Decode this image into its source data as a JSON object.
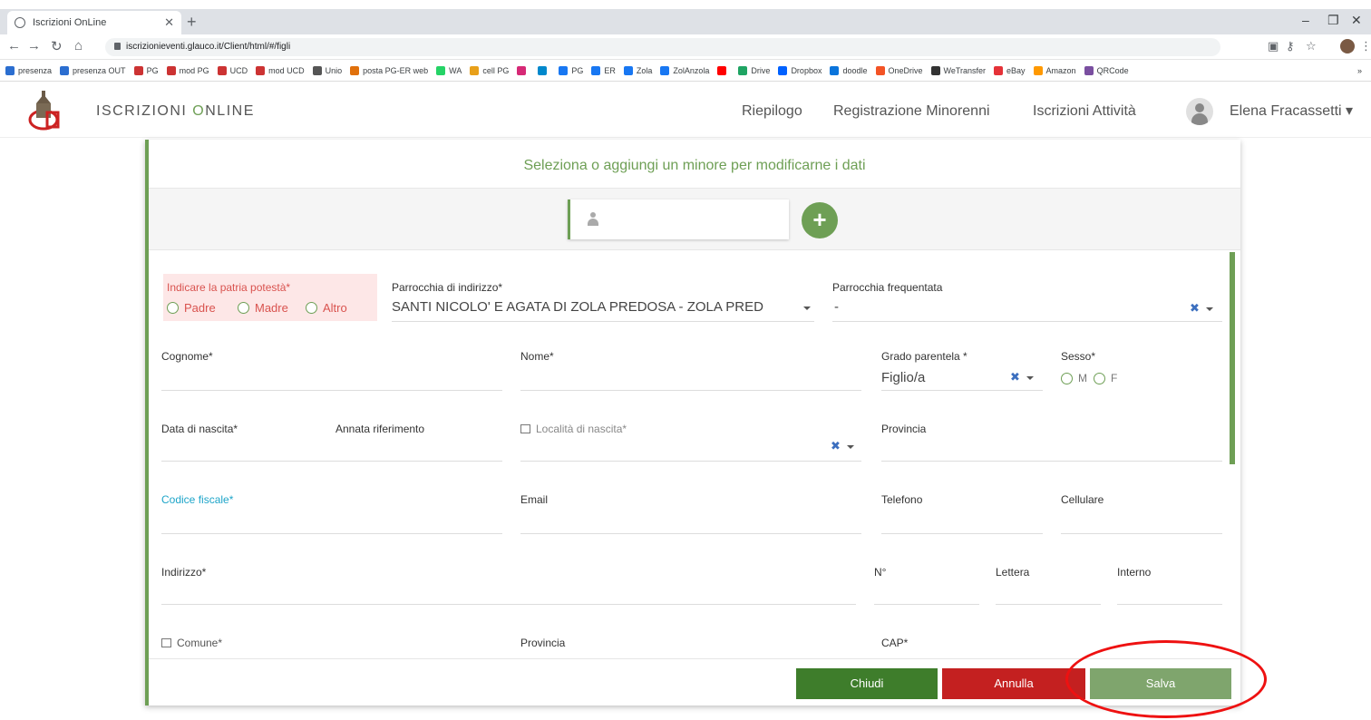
{
  "browser": {
    "tab_title": "Iscrizioni OnLine",
    "url": "iscrizionieventi.glauco.it/Client/html/#/figli",
    "bookmarks": [
      {
        "label": "presenza",
        "color": "#2b6ed0"
      },
      {
        "label": "presenza OUT",
        "color": "#2b6ed0"
      },
      {
        "label": "PG",
        "color": "#c33"
      },
      {
        "label": "mod PG",
        "color": "#c33"
      },
      {
        "label": "UCD",
        "color": "#c33"
      },
      {
        "label": "mod UCD",
        "color": "#c33"
      },
      {
        "label": "Unio",
        "color": "#555"
      },
      {
        "label": "posta PG-ER web",
        "color": "#e0700b"
      },
      {
        "label": "WA",
        "color": "#25d366"
      },
      {
        "label": "cell PG",
        "color": "#e8a01a"
      },
      {
        "label": "",
        "color": "#d62976"
      },
      {
        "label": "",
        "color": "#0088cc"
      },
      {
        "label": "PG",
        "color": "#1877f2"
      },
      {
        "label": "ER",
        "color": "#1877f2"
      },
      {
        "label": "Zola",
        "color": "#1877f2"
      },
      {
        "label": "ZolAnzola",
        "color": "#1877f2"
      },
      {
        "label": "",
        "color": "#ff0000"
      },
      {
        "label": "Drive",
        "color": "#1fa463"
      },
      {
        "label": "Dropbox",
        "color": "#0061ff"
      },
      {
        "label": "doodle",
        "color": "#0a74db"
      },
      {
        "label": "OneDrive",
        "color": "#f35325"
      },
      {
        "label": "WeTransfer",
        "color": "#333"
      },
      {
        "label": "eBay",
        "color": "#e53238"
      },
      {
        "label": "Amazon",
        "color": "#ff9900"
      },
      {
        "label": "QRCode",
        "color": "#7a4fa0"
      }
    ],
    "more": "»"
  },
  "app": {
    "brand_prefix": "IS",
    "brand_mid1": "CRIZIONI ",
    "brand_o": "O",
    "brand_rest": "NLINE",
    "nav": [
      "Riepilogo",
      "Registrazione Minorenni",
      "Iscrizioni Attività"
    ],
    "user": "Elena Fracassetti ▾"
  },
  "modal": {
    "title": "Seleziona o aggiungi un minore per modificarne i dati",
    "add_symbol": "+",
    "patria_label": "Indicare la patria potestà*",
    "patria_options": [
      "Padre",
      "Madre",
      "Altro"
    ],
    "parrocchia_indirizzo_label": "Parrocchia di indirizzo*",
    "parrocchia_indirizzo_value": "SANTI NICOLO' E AGATA DI ZOLA PREDOSA - ZOLA PRED",
    "parrocchia_frequentata_label": "Parrocchia frequentata",
    "parrocchia_frequentata_value": "-",
    "cognome_label": "Cognome*",
    "nome_label": "Nome*",
    "grado_label": "Grado parentela *",
    "grado_value": "Figlio/a",
    "sesso_label": "Sesso*",
    "sesso_options": [
      "M",
      "F"
    ],
    "data_nascita_label": "Data di nascita*",
    "annata_label": "Annata riferimento",
    "localita_label": "Località di nascita*",
    "provincia_label": "Provincia",
    "codice_fiscale_label": "Codice fiscale*",
    "email_label": "Email",
    "telefono_label": "Telefono",
    "cellulare_label": "Cellulare",
    "indirizzo_label": "Indirizzo*",
    "numero_label": "N°",
    "lettera_label": "Lettera",
    "interno_label": "Interno",
    "comune_label": "Comune*",
    "provincia2_label": "Provincia",
    "cap_label": "CAP*",
    "clear_symbol": "✖",
    "buttons": {
      "chiudi": "Chiudi",
      "annulla": "Annulla",
      "salva": "Salva"
    }
  }
}
